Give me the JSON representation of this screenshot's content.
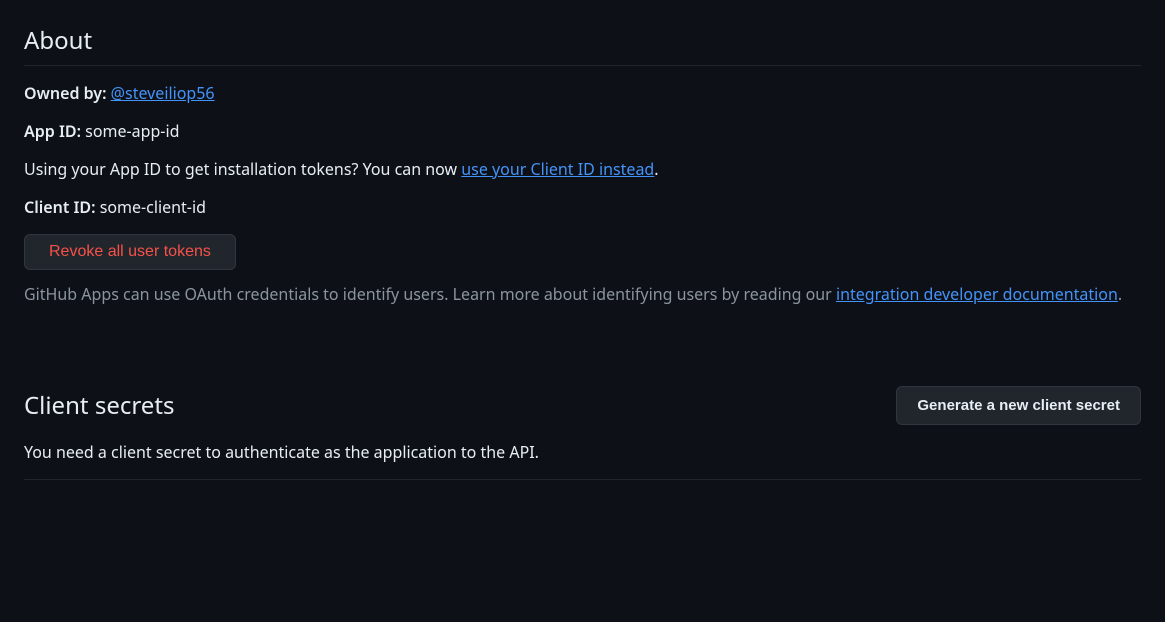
{
  "about": {
    "title": "About",
    "owned_by_label": "Owned by: ",
    "owner_link": "@steveiliop56",
    "app_id_label": "App ID: ",
    "app_id_value": "some-app-id",
    "app_id_hint_prefix": "Using your App ID to get installation tokens? You can now ",
    "app_id_hint_link": "use your Client ID instead",
    "app_id_hint_suffix": ".",
    "client_id_label": "Client ID: ",
    "client_id_value": "some-client-id",
    "revoke_button": "Revoke all user tokens",
    "oauth_help_prefix": "GitHub Apps can use OAuth credentials to identify users. Learn more about identifying users by reading our ",
    "oauth_help_link": "integration developer documentation",
    "oauth_help_suffix": "."
  },
  "secrets": {
    "title": "Client secrets",
    "generate_button": "Generate a new client secret",
    "description": "You need a client secret to authenticate as the application to the API."
  }
}
